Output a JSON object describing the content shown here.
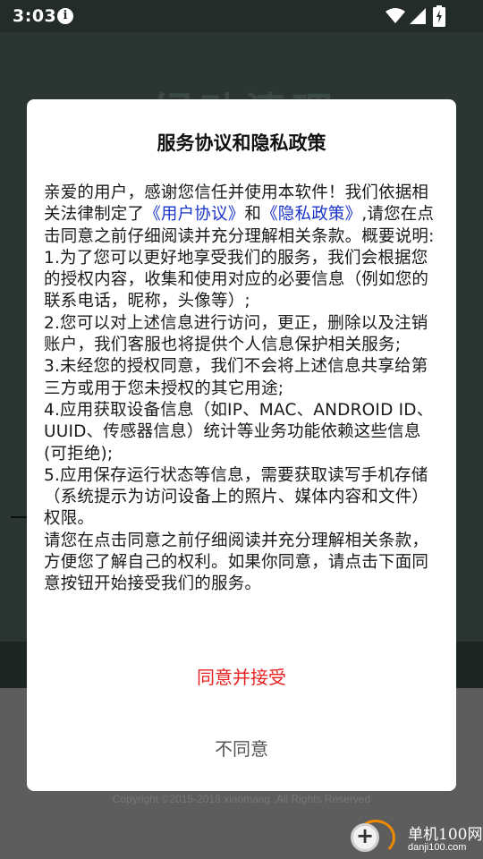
{
  "status_bar": {
    "time": "3:03",
    "info_glyph": "i"
  },
  "background": {
    "title_text": "绿动清理",
    "copyright": "Copyright ©2015-2018 xiaomang .All Rights Reserved"
  },
  "watermark": {
    "name": "单机100网",
    "url": "danji100.com"
  },
  "dialog": {
    "title": "服务协议和隐私政策",
    "intro_prefix": "亲爱的用户，感谢您信任并使用本软件！我们依据相关法律制定了",
    "user_agreement_link": "《用户协议》",
    "and_text": "和",
    "privacy_link": "《隐私政策》",
    "intro_suffix": ",请您在点击同意之前仔细阅读并充分理解相关条款。概要说明:",
    "items": [
      "1.为了您可以更好地享受我们的服务，我们会根据您的授权内容，收集和使用对应的必要信息（例如您的联系电话，昵称，头像等）;",
      "2.您可以对上述信息进行访问，更正，删除以及注销账户，我们客服也将提供个人信息保护相关服务;",
      "3.未经您的授权同意，我们不会将上述信息共享给第三方或用于您未授权的其它用途;",
      "4.应用获取设备信息（如IP、MAC、ANDROID ID、UUID、传感器信息）统计等业务功能依赖这些信息(可拒绝);",
      "5.应用保存运行状态等信息，需要获取读写手机存储（系统提示为访问设备上的照片、媒体内容和文件）权限。"
    ],
    "closing": "请您在点击同意之前仔细阅读并充分理解相关条款，方便您了解自己的权利。如果你同意，请点击下面同意按钮开始接受我们的服务。",
    "agree_label": "同意并接受",
    "disagree_label": "不同意"
  },
  "colors": {
    "link": "#1a35c9",
    "agree": "#e82020",
    "disagree": "#555555"
  },
  "icons": [
    "info-icon",
    "wifi-icon",
    "signal-icon",
    "battery-icon"
  ]
}
